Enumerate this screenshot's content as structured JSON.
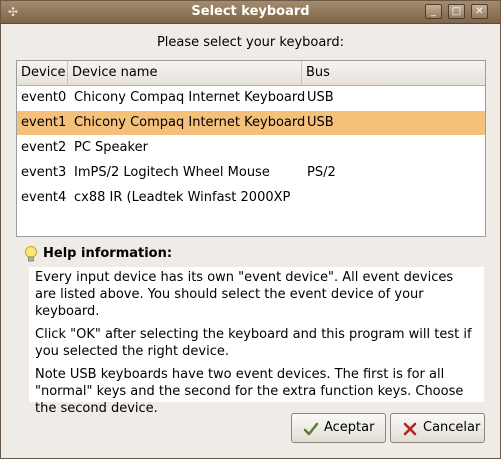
{
  "window": {
    "title": "Select keyboard"
  },
  "prompt": "Please select your keyboard:",
  "table": {
    "headers": {
      "device": "Device",
      "name": "Device name",
      "bus": "Bus"
    },
    "rows": [
      {
        "device": "event0",
        "name": "Chicony Compaq Internet Keyboard",
        "bus": "USB"
      },
      {
        "device": "event1",
        "name": "Chicony Compaq Internet Keyboard",
        "bus": "USB"
      },
      {
        "device": "event2",
        "name": "PC Speaker",
        "bus": ""
      },
      {
        "device": "event3",
        "name": "ImPS/2 Logitech Wheel Mouse",
        "bus": "PS/2"
      },
      {
        "device": "event4",
        "name": "cx88 IR (Leadtek Winfast 2000XP",
        "bus": ""
      }
    ],
    "selected_index": 1
  },
  "help": {
    "title": "Help information:",
    "paragraphs": [
      "Every input device has its own \"event device\". All event devices are listed above. You should select the event device of your keyboard.",
      "Click \"OK\" after selecting the keyboard and this program will test if you selected the right device.",
      "Note USB keyboards have two event devices. The first is for all \"normal\" keys and the second for the extra function keys. Choose the second device."
    ]
  },
  "buttons": {
    "accept": "Aceptar",
    "cancel": "Cancelar"
  },
  "colors": {
    "titlebar": "#8a7053",
    "selection": "#f5c07a"
  }
}
